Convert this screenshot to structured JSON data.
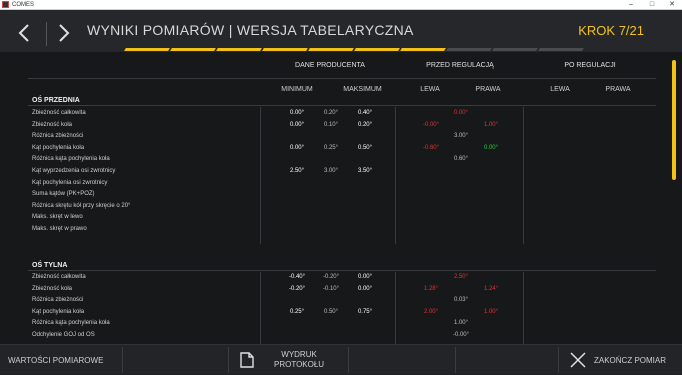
{
  "window": {
    "app_title": "COMES",
    "minimize": "–",
    "maximize": "□",
    "close": "✕"
  },
  "header": {
    "title": "WYNIKI POMIARÓW | WERSJA TABELARYCZNA",
    "step": "KROK 7/21",
    "progress_segments_done": 7,
    "accent_color": "#f2c21b"
  },
  "table": {
    "groups": {
      "producer": "DANE PRODUCENTA",
      "before": "PRZED REGULACJĄ",
      "after": "PO REGULACJI"
    },
    "sub": {
      "min": "MINIMUM",
      "max": "MAKSIMUM",
      "left_before": "LEWA",
      "right_before": "PRAWA",
      "left_after": "LEWA",
      "right_after": "PRAWA"
    },
    "front": {
      "title": "OŚ PRZEDNIA",
      "rows": [
        {
          "label": "Zbieżność całkowita",
          "min": "0.00°",
          "nom": "0.20°",
          "max": "0.40°",
          "bl": "",
          "bc": "0.00°",
          "br": ""
        },
        {
          "label": "Zbieżność koła",
          "min": "0.00°",
          "nom": "0.10°",
          "max": "0.20°",
          "bl": "-0.00°",
          "bc": "",
          "br": "1.00°"
        },
        {
          "label": "Różnica zbieżności",
          "min": "",
          "nom": "",
          "max": "",
          "bl": "",
          "bc": "3.00°",
          "br": ""
        },
        {
          "label": "Kąt pochylenia koła",
          "min": "0.00°",
          "nom": "0.25°",
          "max": "0.50°",
          "bl": "-0.60°",
          "bc": "",
          "br": "0.00°"
        },
        {
          "label": "Różnica kąta pochylenia koła",
          "min": "",
          "nom": "",
          "max": "",
          "bl": "",
          "bc": "0.60°",
          "br": ""
        },
        {
          "label": "Kąt wyprzedzenia osi zwrotnicy",
          "min": "2.50°",
          "nom": "3.00°",
          "max": "3.50°",
          "bl": "",
          "bc": "",
          "br": ""
        },
        {
          "label": "Kąt pochylenia osi zwrotnicy",
          "min": "",
          "nom": "",
          "max": "",
          "bl": "",
          "bc": "",
          "br": ""
        },
        {
          "label": "Suma kątów (PK+POZ)",
          "min": "",
          "nom": "",
          "max": "",
          "bl": "",
          "bc": "",
          "br": ""
        },
        {
          "label": "Różnica skrętu kół przy skręcie o 20°",
          "min": "",
          "nom": "",
          "max": "",
          "bl": "",
          "bc": "",
          "br": ""
        },
        {
          "label": "Maks. skręt w lewo",
          "min": "",
          "nom": "",
          "max": "",
          "bl": "",
          "bc": "",
          "br": ""
        },
        {
          "label": "Maks. skręt w prawo",
          "min": "",
          "nom": "",
          "max": "",
          "bl": "",
          "bc": "",
          "br": ""
        }
      ]
    },
    "rear": {
      "title": "OŚ TYLNA",
      "rows": [
        {
          "label": "Zbieżność całkowita",
          "min": "-0.40°",
          "nom": "-0.20°",
          "max": "0.00°",
          "bl": "",
          "bc": "2.50°",
          "br": ""
        },
        {
          "label": "Zbieżność koła",
          "min": "-0.20°",
          "nom": "-0.10°",
          "max": "0.00°",
          "bl": "1.28°",
          "bc": "",
          "br": "1.24°"
        },
        {
          "label": "Różnica zbieżności",
          "min": "",
          "nom": "",
          "max": "",
          "bl": "",
          "bc": "0.03°",
          "br": ""
        },
        {
          "label": "Kąt pochylenia koła",
          "min": "0.25°",
          "nom": "0.50°",
          "max": "0.75°",
          "bl": "2.00°",
          "bc": "",
          "br": "1.00°"
        },
        {
          "label": "Różnica kąta pochylenia koła",
          "min": "",
          "nom": "",
          "max": "",
          "bl": "",
          "bc": "1.00°",
          "br": ""
        },
        {
          "label": "Odchylenie GOJ od OS",
          "min": "",
          "nom": "",
          "max": "",
          "bl": "",
          "bc": "-0.00°",
          "br": ""
        }
      ]
    }
  },
  "footer": {
    "measurements": "WARTOŚCI POMIAROWE",
    "print_line1": "WYDRUK",
    "print_line2": "PROTOKOŁU",
    "finish": "ZAKOŃCZ POMIAR"
  }
}
